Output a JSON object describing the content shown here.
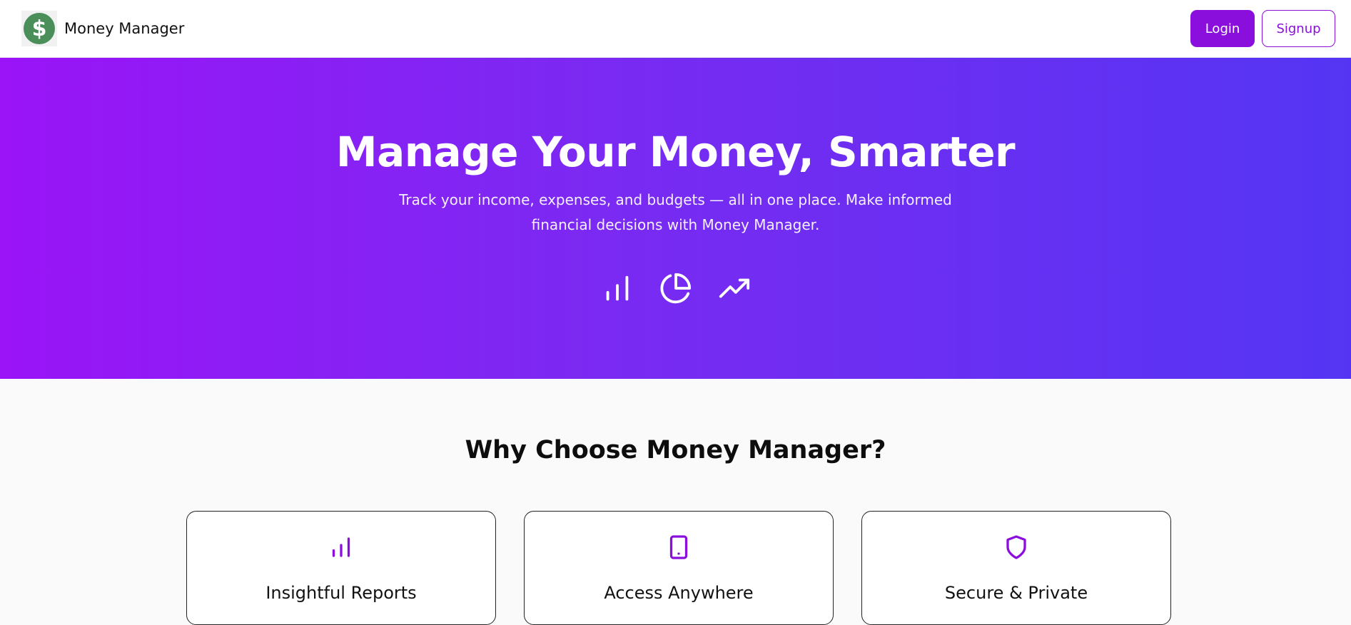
{
  "navbar": {
    "logo_icon": "dollar-icon",
    "brand_name": "Money Manager",
    "login_label": "Login",
    "signup_label": "Signup"
  },
  "hero": {
    "title": "Manage Your Money, Smarter",
    "subtitle": "Track your income, expenses, and budgets — all in one place. Make informed financial decisions with Money Manager.",
    "icons": [
      "bar-chart-icon",
      "pie-chart-icon",
      "trending-up-icon"
    ]
  },
  "features": {
    "title": "Why Choose Money Manager?",
    "cards": [
      {
        "title": "Insightful Reports",
        "icon": "bar-chart-icon"
      },
      {
        "title": "Access Anywhere",
        "icon": "tablet-icon"
      },
      {
        "title": "Secure & Private",
        "icon": "shield-icon"
      }
    ]
  },
  "colors": {
    "accent": "#8a0fdd",
    "gradient_start": "#9a14f7",
    "gradient_end": "#5535f3",
    "logo_green": "#4a8f5a"
  }
}
